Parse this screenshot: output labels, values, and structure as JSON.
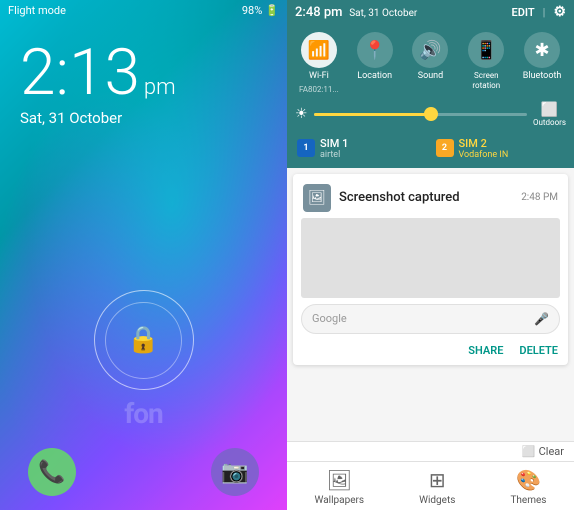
{
  "left": {
    "status_bar": {
      "flight_mode": "Flight mode",
      "battery": "98%"
    },
    "time": "2:13",
    "ampm": "pm",
    "date": "Sat, 31 October",
    "watermark": "fon",
    "bottom": {
      "phone_icon": "📞",
      "camera_icon": "📷"
    }
  },
  "right": {
    "status": {
      "time": "2:48 pm",
      "date": "Sat, 31 October",
      "edit": "EDIT",
      "settings_icon": "⚙"
    },
    "toggles": [
      {
        "icon": "📶",
        "label": "Wi-Fi",
        "sublabel": "FA802:11...",
        "active": true
      },
      {
        "icon": "📍",
        "label": "Location",
        "sublabel": "",
        "active": false
      },
      {
        "icon": "🔊",
        "label": "Sound",
        "sublabel": "",
        "active": false
      },
      {
        "icon": "📱",
        "label": "Screen rotation",
        "sublabel": "",
        "active": false
      },
      {
        "icon": "✱",
        "label": "Bluetooth",
        "sublabel": "",
        "active": false
      }
    ],
    "brightness": {
      "outdoors": "Outdoors"
    },
    "sim1": {
      "number": "1",
      "name": "SIM 1",
      "carrier": "airtel"
    },
    "sim2": {
      "number": "2",
      "name": "SIM 2",
      "carrier": "Vodafone IN"
    },
    "notification": {
      "title": "Screenshot captured",
      "time": "2:48 PM",
      "share": "SHARE",
      "delete": "DELETE",
      "search_placeholder": "Google"
    },
    "bottom": {
      "clear": "Clear",
      "wallpapers": "Wallpapers",
      "widgets": "Widgets",
      "themes": "Themes"
    }
  }
}
